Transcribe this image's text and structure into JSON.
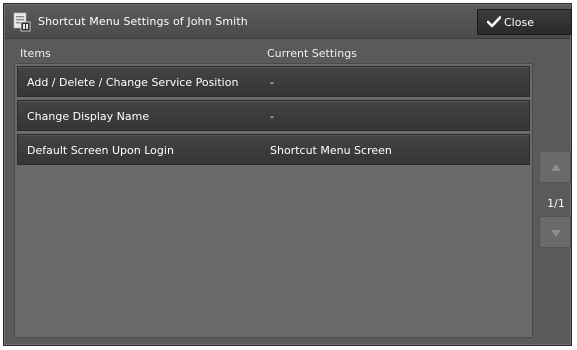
{
  "window": {
    "title": "Shortcut Menu Settings of John Smith",
    "close_label": "Close",
    "title_icon": "settings-document-icon"
  },
  "columns": {
    "items": "Items",
    "current_settings": "Current Settings"
  },
  "rows": [
    {
      "item": "Add / Delete / Change Service Position",
      "setting": "-"
    },
    {
      "item": "Change Display Name",
      "setting": "-"
    },
    {
      "item": "Default Screen Upon Login",
      "setting": "Shortcut Menu Screen"
    }
  ],
  "pager": {
    "indicator": "1/1",
    "up_icon": "triangle-up-icon",
    "down_icon": "triangle-down-icon"
  },
  "colors": {
    "background": "#5a5a5a",
    "row": "#3c3c3c",
    "panel": "#6a6a6a"
  }
}
